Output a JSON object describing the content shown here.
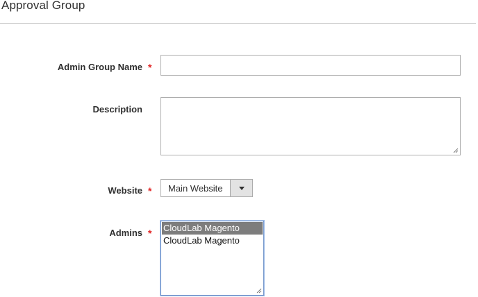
{
  "section": {
    "title": "Approval Group"
  },
  "form": {
    "admin_group_name": {
      "label": "Admin Group Name",
      "required_marker": "*",
      "value": ""
    },
    "description": {
      "label": "Description",
      "value": ""
    },
    "website": {
      "label": "Website",
      "required_marker": "*",
      "selected": "Main Website"
    },
    "admins": {
      "label": "Admins",
      "required_marker": "*",
      "options": [
        {
          "label": "CloudLab Magento",
          "selected": true
        },
        {
          "label": "CloudLab Magento",
          "selected": false
        }
      ]
    }
  },
  "colors": {
    "required": "#e22626",
    "selected_option_bg": "#7d7d7d",
    "focus_border": "#6b8fc7"
  },
  "icons": {
    "dropdown_arrow": "chevron-down-icon",
    "resize_grip": "resize-handle-icon"
  }
}
